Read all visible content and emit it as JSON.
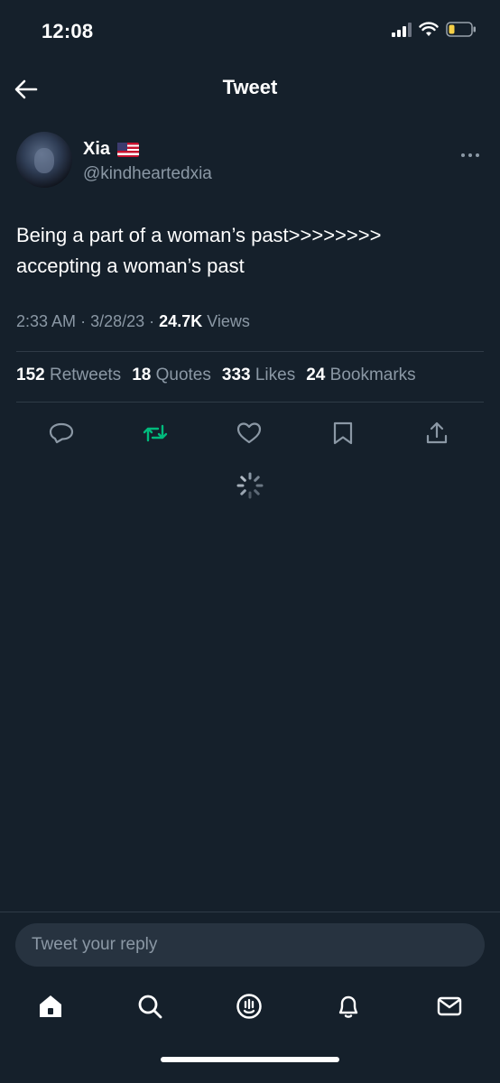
{
  "status_bar": {
    "time": "12:08",
    "icons": [
      "cellular-signal-icon",
      "wifi-icon",
      "battery-low-icon"
    ],
    "battery_color": "#f7d046"
  },
  "header": {
    "title": "Tweet",
    "back_icon": "arrow-left-icon"
  },
  "tweet": {
    "author_name": "Xia",
    "author_flag": "🇺🇸",
    "author_handle": "@kindheartedxia",
    "text_line1": "Being a part of a woman’s past>>>>>>>>",
    "text_line2": "accepting a woman’s past",
    "time": "2:33 AM",
    "date": "3/28/23",
    "views_count": "24.7K",
    "views_label": "Views",
    "separator": "·"
  },
  "stats": {
    "retweets_count": "152",
    "retweets_label": "Retweets",
    "quotes_count": "18",
    "quotes_label": "Quotes",
    "likes_count": "333",
    "likes_label": "Likes",
    "bookmarks_count": "24",
    "bookmarks_label": "Bookmarks"
  },
  "actions": {
    "icons": [
      "reply-icon",
      "retweet-icon",
      "like-icon",
      "bookmark-icon",
      "share-icon"
    ],
    "retweet_color": "#00ba7c",
    "icon_color": "#8b98a5"
  },
  "reply": {
    "placeholder": "Tweet your reply"
  },
  "bottom_nav": {
    "icons": [
      "home-icon",
      "search-icon",
      "spaces-icon",
      "notifications-icon",
      "messages-icon"
    ]
  },
  "colors": {
    "background": "#15202b",
    "secondary_text": "#8b98a5",
    "divider": "#2f3b47"
  }
}
